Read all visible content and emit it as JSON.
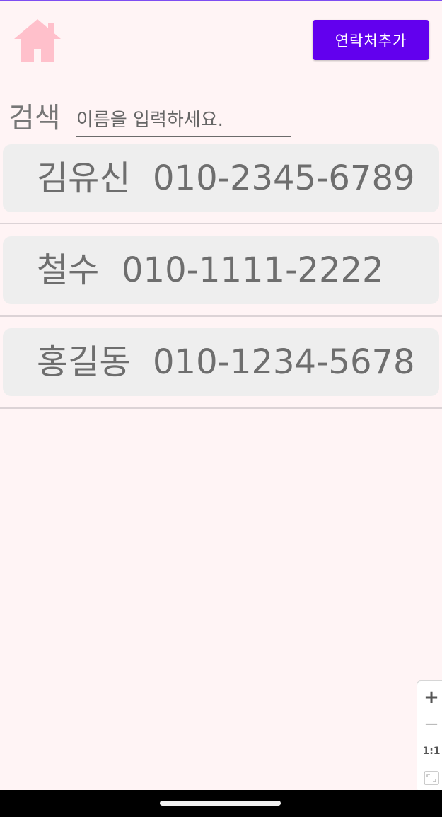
{
  "header": {
    "home_icon": "home-icon",
    "add_button_label": "연락처추가"
  },
  "search": {
    "label": "검색",
    "placeholder": "이름을 입력하세요.",
    "value": ""
  },
  "contacts": [
    {
      "name": "김유신",
      "phone": "010-2345-6789"
    },
    {
      "name": "철수",
      "phone": "010-1111-2222"
    },
    {
      "name": "홍길동",
      "phone": "010-1234-5678"
    }
  ],
  "zoom_controls": {
    "zoom_in": "+",
    "zoom_out": "−",
    "actual_size": "1:1",
    "fit_icon": "fit-screen-icon"
  },
  "colors": {
    "background": "#fff4f5",
    "accent": "#6200ee",
    "home_icon": "#ffc0cb",
    "row_background": "#eeeeee"
  }
}
